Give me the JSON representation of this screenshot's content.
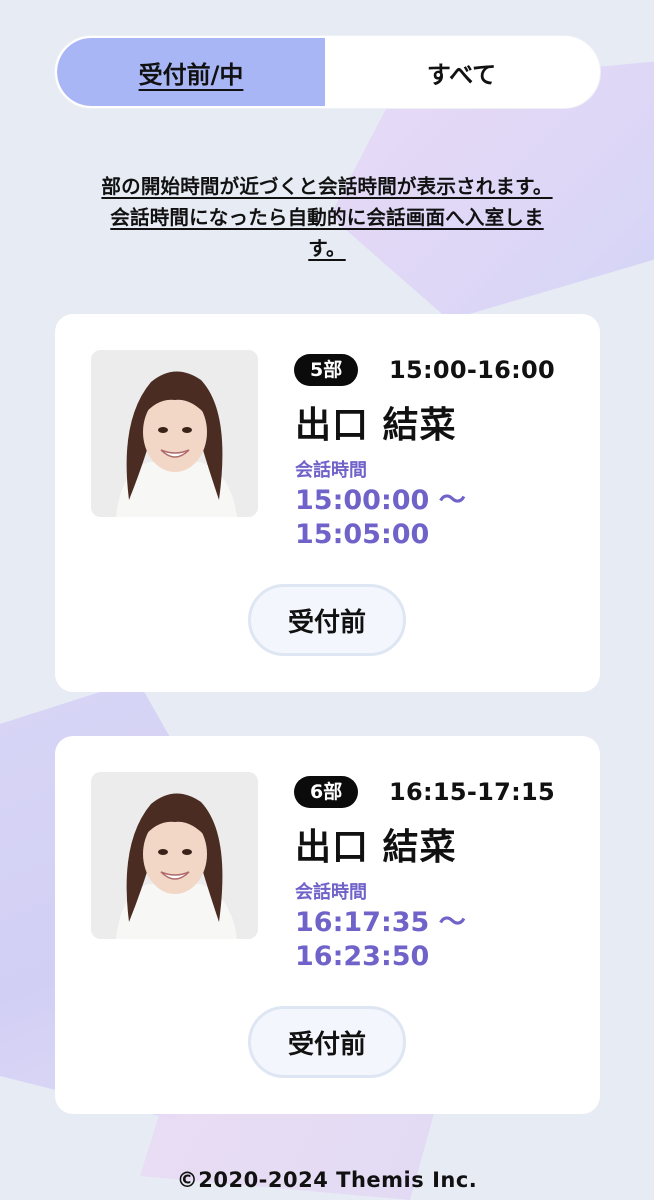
{
  "tabs": {
    "active_label": "受付前/中",
    "all_label": "すべて"
  },
  "notice": {
    "line1": "部の開始時間が近づくと会話時間が表示されます。",
    "line2": "会話時間になったら自動的に会話画面へ入室しま",
    "line3": "す。"
  },
  "cards": [
    {
      "part": "5部",
      "time_range": "15:00-16:00",
      "name": "出口 結菜",
      "talk_label": "会話時間",
      "talk_start": "15:00:00 〜",
      "talk_end": "15:05:00",
      "status": "受付前"
    },
    {
      "part": "6部",
      "time_range": "16:15-17:15",
      "name": "出口 結菜",
      "talk_label": "会話時間",
      "talk_start": "16:17:35 〜",
      "talk_end": "16:23:50",
      "status": "受付前"
    }
  ],
  "footer": {
    "copyright": "©2020-2024 Themis Inc."
  },
  "colors": {
    "background": "#e6ebf4",
    "tab_active": "#a9b6f5",
    "accent_purple": "#6f62c8",
    "badge": "#0b0b0b"
  }
}
